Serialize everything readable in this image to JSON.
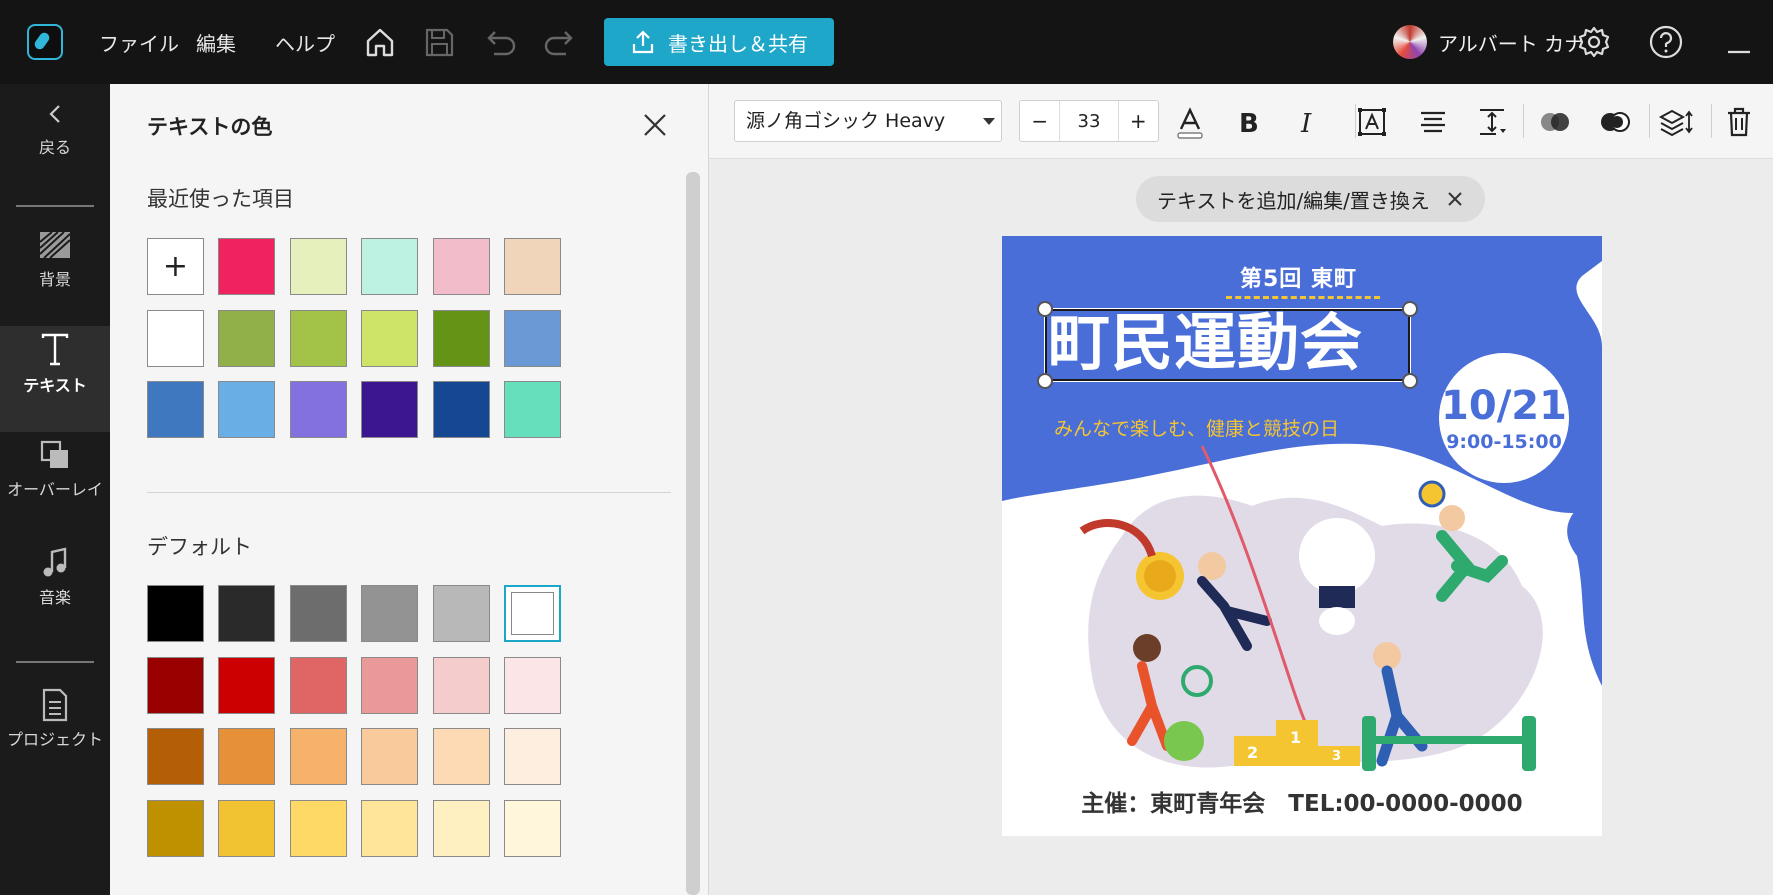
{
  "menu": {
    "file": "ファイル",
    "edit": "編集",
    "help": "ヘルプ"
  },
  "toolbar_top": {
    "export_label": "書き出し＆共有",
    "user_name": "アルバート カナ"
  },
  "nav": {
    "back": "戻る",
    "background": "背景",
    "text": "テキスト",
    "overlay": "オーバーレイ",
    "music": "音楽",
    "project": "プロジェクト"
  },
  "panel": {
    "title": "テキストの色",
    "recent_label": "最近使った項目",
    "default_label": "デフォルト",
    "add_symbol": "+",
    "recent_colors": [
      "#f0235f",
      "#e6f0bd",
      "#bdf2e2",
      "#f2bccb",
      "#f0d5bb",
      "#ffffff",
      "#92b04a",
      "#a2c347",
      "#cde468",
      "#649416",
      "#6b99d6",
      "#3f78bf",
      "#6aaee6",
      "#8371e0",
      "#3b1690",
      "#154792",
      "#66e0bc"
    ],
    "default_colors": [
      "#000000",
      "#2a2a2a",
      "#6d6d6d",
      "#939393",
      "#b8b8b8",
      "#ffffff",
      "#990000",
      "#cc0000",
      "#e06666",
      "#ea9999",
      "#f4cccc",
      "#fce5e6",
      "#b45f06",
      "#e69138",
      "#f6b26b",
      "#f9cb9c",
      "#fdd9b4",
      "#fdeedf",
      "#bf9000",
      "#f1c232",
      "#ffd966",
      "#ffe599",
      "#fff0c2",
      "#fff6dc"
    ]
  },
  "text_toolbar": {
    "font_name": "源ノ角ゴシック Heavy",
    "font_size": "33",
    "minus": "−",
    "plus": "+"
  },
  "chip": {
    "label": "テキストを追加/編集/置き換え"
  },
  "poster": {
    "top_text": "第5回 東町",
    "title": "町民運動会",
    "subtitle": "みんなで楽しむ、健康と競技の日",
    "date": "10/21",
    "time": "9:00-15:00",
    "footer": "主催：東町青年会　TEL:00-0000-0000",
    "podium": [
      "2",
      "1",
      "3"
    ],
    "colors": {
      "blue": "#4a6ed8",
      "yellow": "#f4c531",
      "lavender": "#e1dbe8"
    }
  },
  "colors": {
    "accent": "#1fa7c9",
    "topbar": "#141414",
    "nav": "#1b1b1b"
  }
}
